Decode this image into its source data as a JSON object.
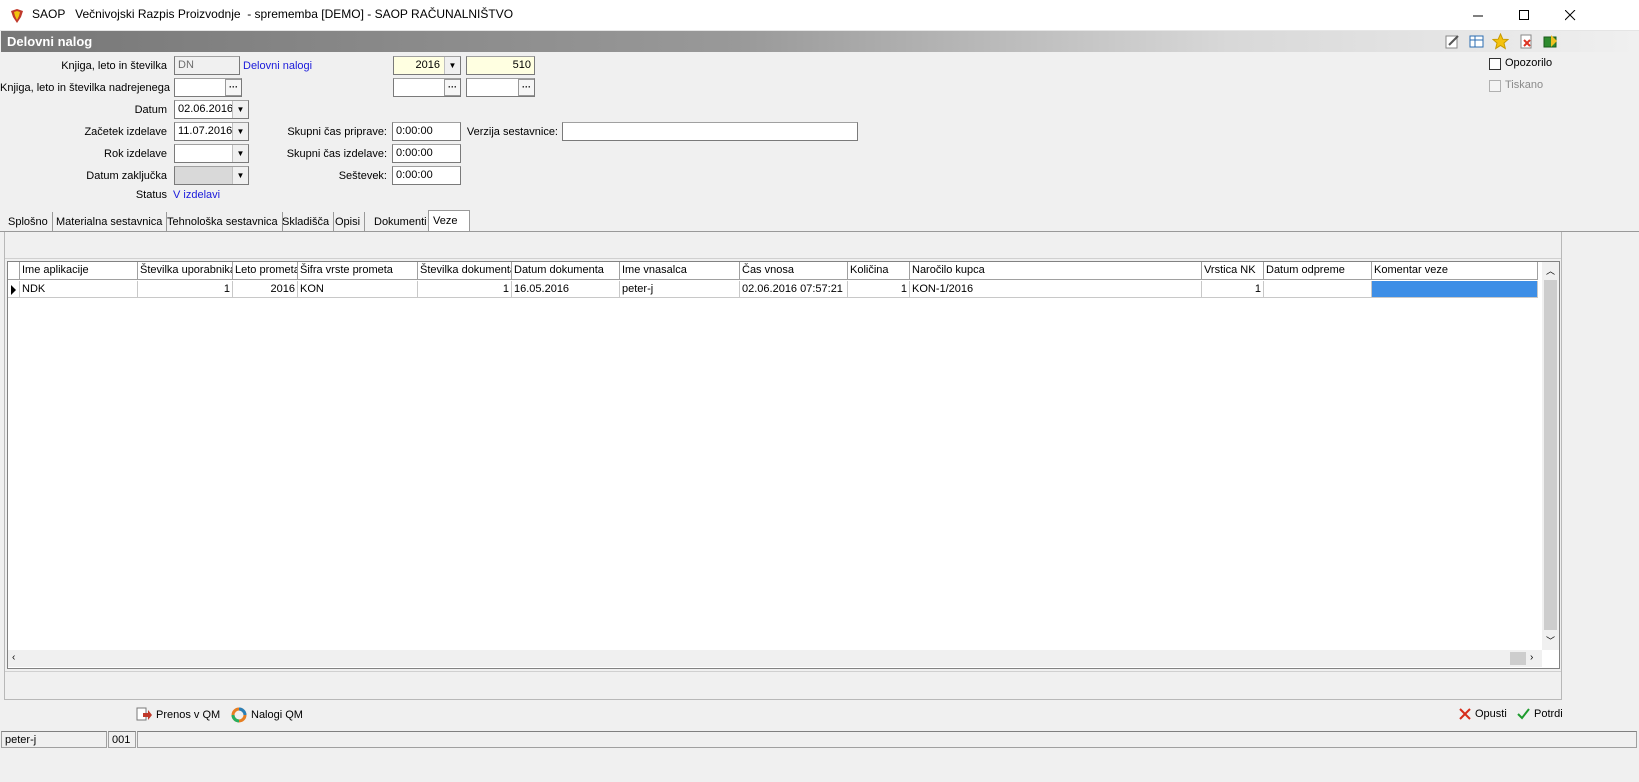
{
  "window": {
    "title": "SAOP   Večnivojski Razpis Proizvodnje  - sprememba [DEMO] - SAOP RAČUNALNIŠTVO"
  },
  "panel": {
    "title": "Delovni nalog"
  },
  "form": {
    "knjiga_label": "Knjiga, leto in številka",
    "knjiga_value": "DN",
    "knjiga_link": "Delovni nalogi",
    "leto_value": "2016",
    "stevilka_value": "510",
    "nadrejen_label": "Knjiga, leto in številka nadrejenega",
    "datum_label": "Datum",
    "datum_value": "02.06.2016",
    "zacetek_label": "Začetek izdelave",
    "zacetek_value": "11.07.2016",
    "rok_label": "Rok izdelave",
    "zakljucek_label": "Datum zaključka",
    "status_label": "Status",
    "status_value": "V izdelavi",
    "priprava_label": "Skupni čas priprave:",
    "priprava_value": "0:00:00",
    "izdelava_label": "Skupni čas izdelave:",
    "izdelava_value": "0:00:00",
    "sestevek_label": "Seštevek:",
    "sestevek_value": "0:00:00",
    "verzija_label": "Verzija sestavnice:",
    "verzija_value": "",
    "opozorilo_label": "Opozorilo",
    "tiskano_label": "Tiskano"
  },
  "tabs": [
    "Splošno",
    "Materialna sestavnica",
    "Tehnološka sestavnica",
    "Skladišča",
    "Opisi",
    "Dokumenti",
    "Veze"
  ],
  "grid": {
    "headers": [
      "Ime aplikacije",
      "Številka uporabnika",
      "Leto prometa",
      "Šifra vrste prometa",
      "Številka dokumenta",
      "Datum dokumenta",
      "Ime vnasalca",
      "Čas vnosa",
      "Količina",
      "Naročilo kupca",
      "Vrstica NK",
      "Datum odpreme",
      "Komentar veze"
    ],
    "rows": [
      [
        "NDK",
        "1",
        "2016",
        "KON",
        "1",
        "16.05.2016",
        "peter-j",
        "02.06.2016 07:57:21",
        "1",
        "KON-1/2016",
        "1",
        "",
        ""
      ]
    ]
  },
  "buttons": {
    "prenos": "Prenos v QM",
    "nalogi": "Nalogi QM",
    "opusti": "Opusti",
    "potrdi": "Potrdi"
  },
  "statusbar": {
    "user": "peter-j",
    "code": "001"
  },
  "colors": {
    "selection": "#3d8ee6",
    "link": "#1a1adb",
    "required_field": "#ffffe1"
  }
}
